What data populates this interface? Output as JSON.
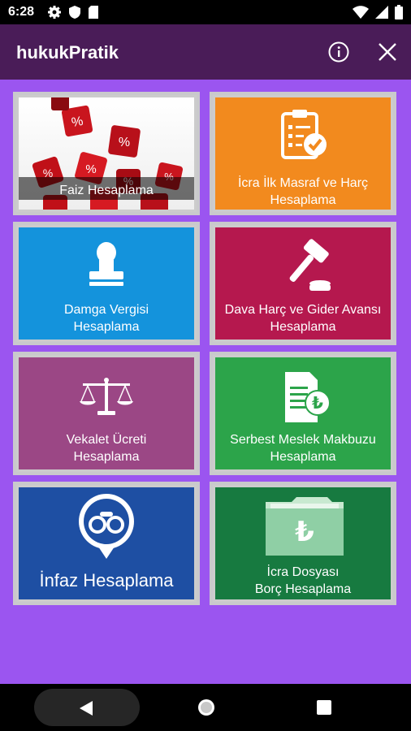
{
  "status": {
    "time": "6:28"
  },
  "app": {
    "title": "hukukPratik"
  },
  "tiles": [
    {
      "label": "Faiz Hesaplama",
      "color": "#ffffff"
    },
    {
      "line1": "İcra İlk Masraf ve Harç",
      "line2": "Hesaplama",
      "color": "#f28a1e"
    },
    {
      "line1": "Damga Vergisi",
      "line2": "Hesaplama",
      "color": "#1493dc"
    },
    {
      "line1": "Dava Harç ve Gider Avansı",
      "line2": "Hesaplama",
      "color": "#b5184e"
    },
    {
      "line1": "Vekalet Ücreti",
      "line2": "Hesaplama",
      "color": "#9b4785"
    },
    {
      "line1": "Serbest Meslek Makbuzu",
      "line2": "Hesaplama",
      "color": "#2ca44a"
    },
    {
      "label": "İnfaz Hesaplama",
      "color": "#1e4fa3"
    },
    {
      "line1": "İcra Dosyası",
      "line2": "Borç Hesaplama",
      "color": "#177a40"
    }
  ]
}
